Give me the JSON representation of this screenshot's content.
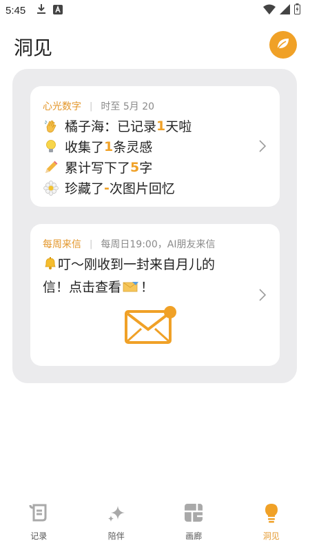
{
  "status_bar": {
    "time": "5:45"
  },
  "header": {
    "title": "洞见"
  },
  "colors": {
    "accent": "#f0a127",
    "panel_bg": "#ebebed",
    "muted": "#8a8a8a"
  },
  "stats_card": {
    "tag": "心光数字",
    "subtitle": "时至 5月 20",
    "lines": [
      {
        "icon": "waving-hand-icon",
        "pre": "橘子海：已记录",
        "value": "1",
        "post": "天啦"
      },
      {
        "icon": "light-bulb-icon",
        "pre": "收集了",
        "value": "1",
        "post": "条灵感"
      },
      {
        "icon": "pencil-icon",
        "pre": "累计写下了",
        "value": "5",
        "post": "字"
      },
      {
        "icon": "flower-icon",
        "pre": "珍藏了",
        "value": "-",
        "post": "次图片回忆"
      }
    ]
  },
  "letter_card": {
    "tag": "每周来信",
    "subtitle": "每周日19:00，AI朋友来信",
    "message_pre": "叮～刚收到一封来自月儿的信！点击查看",
    "message_post": "！"
  },
  "tabs": [
    {
      "label": "记录",
      "icon": "scroll-icon",
      "active": false
    },
    {
      "label": "陪伴",
      "icon": "sparkles-icon",
      "active": false
    },
    {
      "label": "画廊",
      "icon": "gallery-grid-icon",
      "active": false
    },
    {
      "label": "洞见",
      "icon": "bulb-icon",
      "active": true
    }
  ]
}
